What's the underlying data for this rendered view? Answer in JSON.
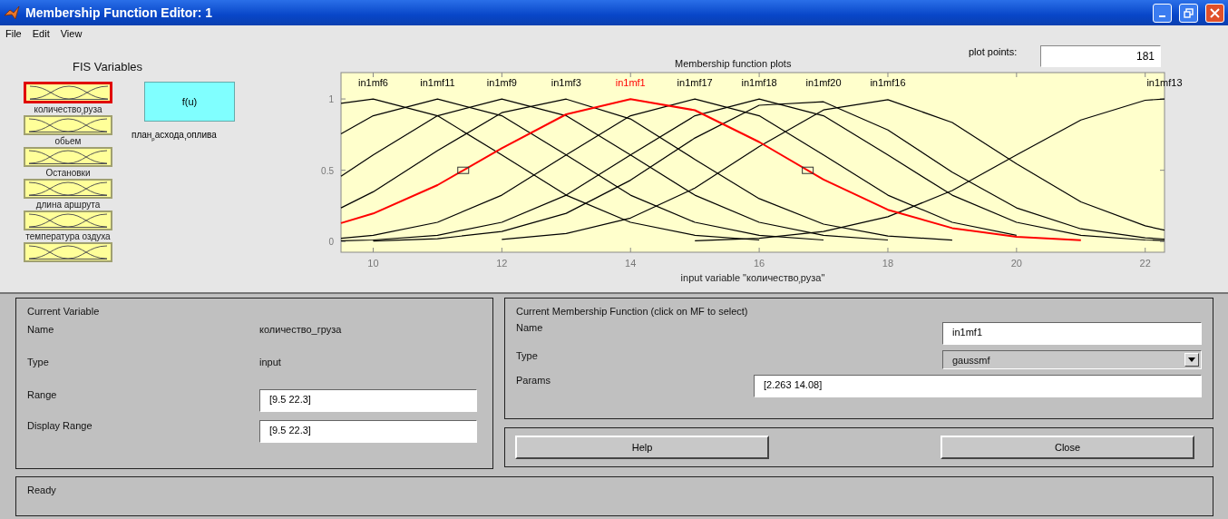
{
  "window": {
    "title": "Membership Function Editor: 1"
  },
  "menu": [
    "File",
    "Edit",
    "View"
  ],
  "fis_variables": {
    "title": "FIS Variables",
    "inputs": [
      {
        "label": "количество$_{г}$руза",
        "selected": true
      },
      {
        "label": "обьем",
        "selected": false
      },
      {
        "label": "Остановки",
        "selected": false
      },
      {
        "label": "длина аршрута",
        "selected": false
      },
      {
        "label": "температура оздуха",
        "selected": false
      },
      {
        "selected": false
      }
    ],
    "output": {
      "symbol": "f(u)",
      "label": "план$_{р}$асхода$_{т}$оплива",
      "selected": false
    }
  },
  "plot": {
    "plot_points_label": "plot points:",
    "plot_points": "181",
    "chart_data": {
      "type": "line",
      "title": "Membership function plots",
      "xlabel": "input variable \"количество$_{г}$руза\"",
      "xlim": [
        9.5,
        22.3
      ],
      "ylim": [
        -0.075,
        1.185
      ],
      "xticks": [
        10,
        12,
        14,
        16,
        18,
        20,
        22
      ],
      "yticks": [
        0,
        0.5,
        1
      ],
      "x": [
        9.5,
        10,
        11,
        12,
        13,
        14,
        15,
        16,
        17,
        18,
        19,
        20,
        21,
        22,
        22.3
      ],
      "series": [
        {
          "name": "in1mf6",
          "color": "#000000",
          "values": [
            0.969,
            1,
            0.882,
            0.607,
            0.325,
            0.135,
            0.044,
            0.011,
            null,
            null,
            null,
            null,
            null,
            null,
            null
          ]
        },
        {
          "name": "in1mf11",
          "color": "#000000",
          "values": [
            0.755,
            0.882,
            1,
            0.882,
            0.607,
            0.325,
            0.135,
            0.044,
            0.011,
            null,
            null,
            null,
            null,
            null,
            null
          ]
        },
        {
          "name": "in1mf9",
          "color": "#000000",
          "values": [
            0.458,
            0.607,
            0.882,
            1,
            0.882,
            0.607,
            0.325,
            0.135,
            0.044,
            0.011,
            null,
            null,
            null,
            null,
            null
          ]
        },
        {
          "name": "in1mf3",
          "color": "#000000",
          "values": [
            0.236,
            0.349,
            0.637,
            0.904,
            0.999,
            0.86,
            0.576,
            0.301,
            0.122,
            0.039,
            0.01,
            null,
            null,
            null,
            null
          ]
        },
        {
          "name": "in1mf17",
          "color": "#000000",
          "values": [
            0.023,
            0.044,
            0.135,
            0.325,
            0.607,
            0.882,
            1,
            0.882,
            0.607,
            0.325,
            0.135,
            0.044,
            null,
            null,
            null
          ]
        },
        {
          "name": "in1mf18",
          "color": "#000000",
          "values": [
            0.005,
            0.011,
            0.044,
            0.135,
            0.325,
            0.607,
            0.882,
            1,
            0.882,
            0.607,
            0.325,
            0.135,
            0.044,
            0.011,
            0.007
          ]
        },
        {
          "name": "in1mf20",
          "color": "#000000",
          "values": [
            null,
            0.004,
            0.02,
            0.071,
            0.198,
            0.43,
            0.726,
            0.956,
            0.98,
            0.783,
            0.487,
            0.236,
            0.089,
            0.026,
            0.017
          ]
        },
        {
          "name": "in1mf16",
          "color": "#000000",
          "values": [
            null,
            null,
            null,
            0.015,
            0.056,
            0.165,
            0.375,
            0.667,
            0.923,
            0.995,
            0.835,
            0.546,
            0.278,
            0.11,
            0.08
          ]
        },
        {
          "name": "in1mf13",
          "color": "#000000",
          "values": [
            null,
            null,
            null,
            null,
            null,
            null,
            0.006,
            0.023,
            0.07,
            0.174,
            0.358,
            0.607,
            0.852,
            0.991,
            1
          ]
        },
        {
          "name": "in1mf1",
          "color": "#ff0000",
          "values": [
            0.129,
            0.197,
            0.396,
            0.655,
            0.892,
            0.999,
            0.921,
            0.698,
            0.435,
            0.223,
            0.094,
            0.033,
            0.009,
            null,
            null
          ]
        }
      ]
    }
  },
  "current_variable": {
    "title": "Current Variable",
    "fields": [
      {
        "label": "Name",
        "value": "количество_груза",
        "kind": "text"
      },
      {
        "label": "Type",
        "value": "input",
        "kind": "text"
      },
      {
        "label": "Range",
        "value": "[9.5 22.3]",
        "kind": "input"
      },
      {
        "label": "Display Range",
        "value": "[9.5 22.3]",
        "kind": "input"
      }
    ]
  },
  "current_mf": {
    "title": "Current Membership Function (click on MF to select)",
    "name_label": "Name",
    "name": "in1mf1",
    "type_label": "Type",
    "type": "gaussmf",
    "params_label": "Params",
    "params": "[2.263 14.08]"
  },
  "buttons": [
    "Help",
    "Close"
  ],
  "status": "Ready"
}
